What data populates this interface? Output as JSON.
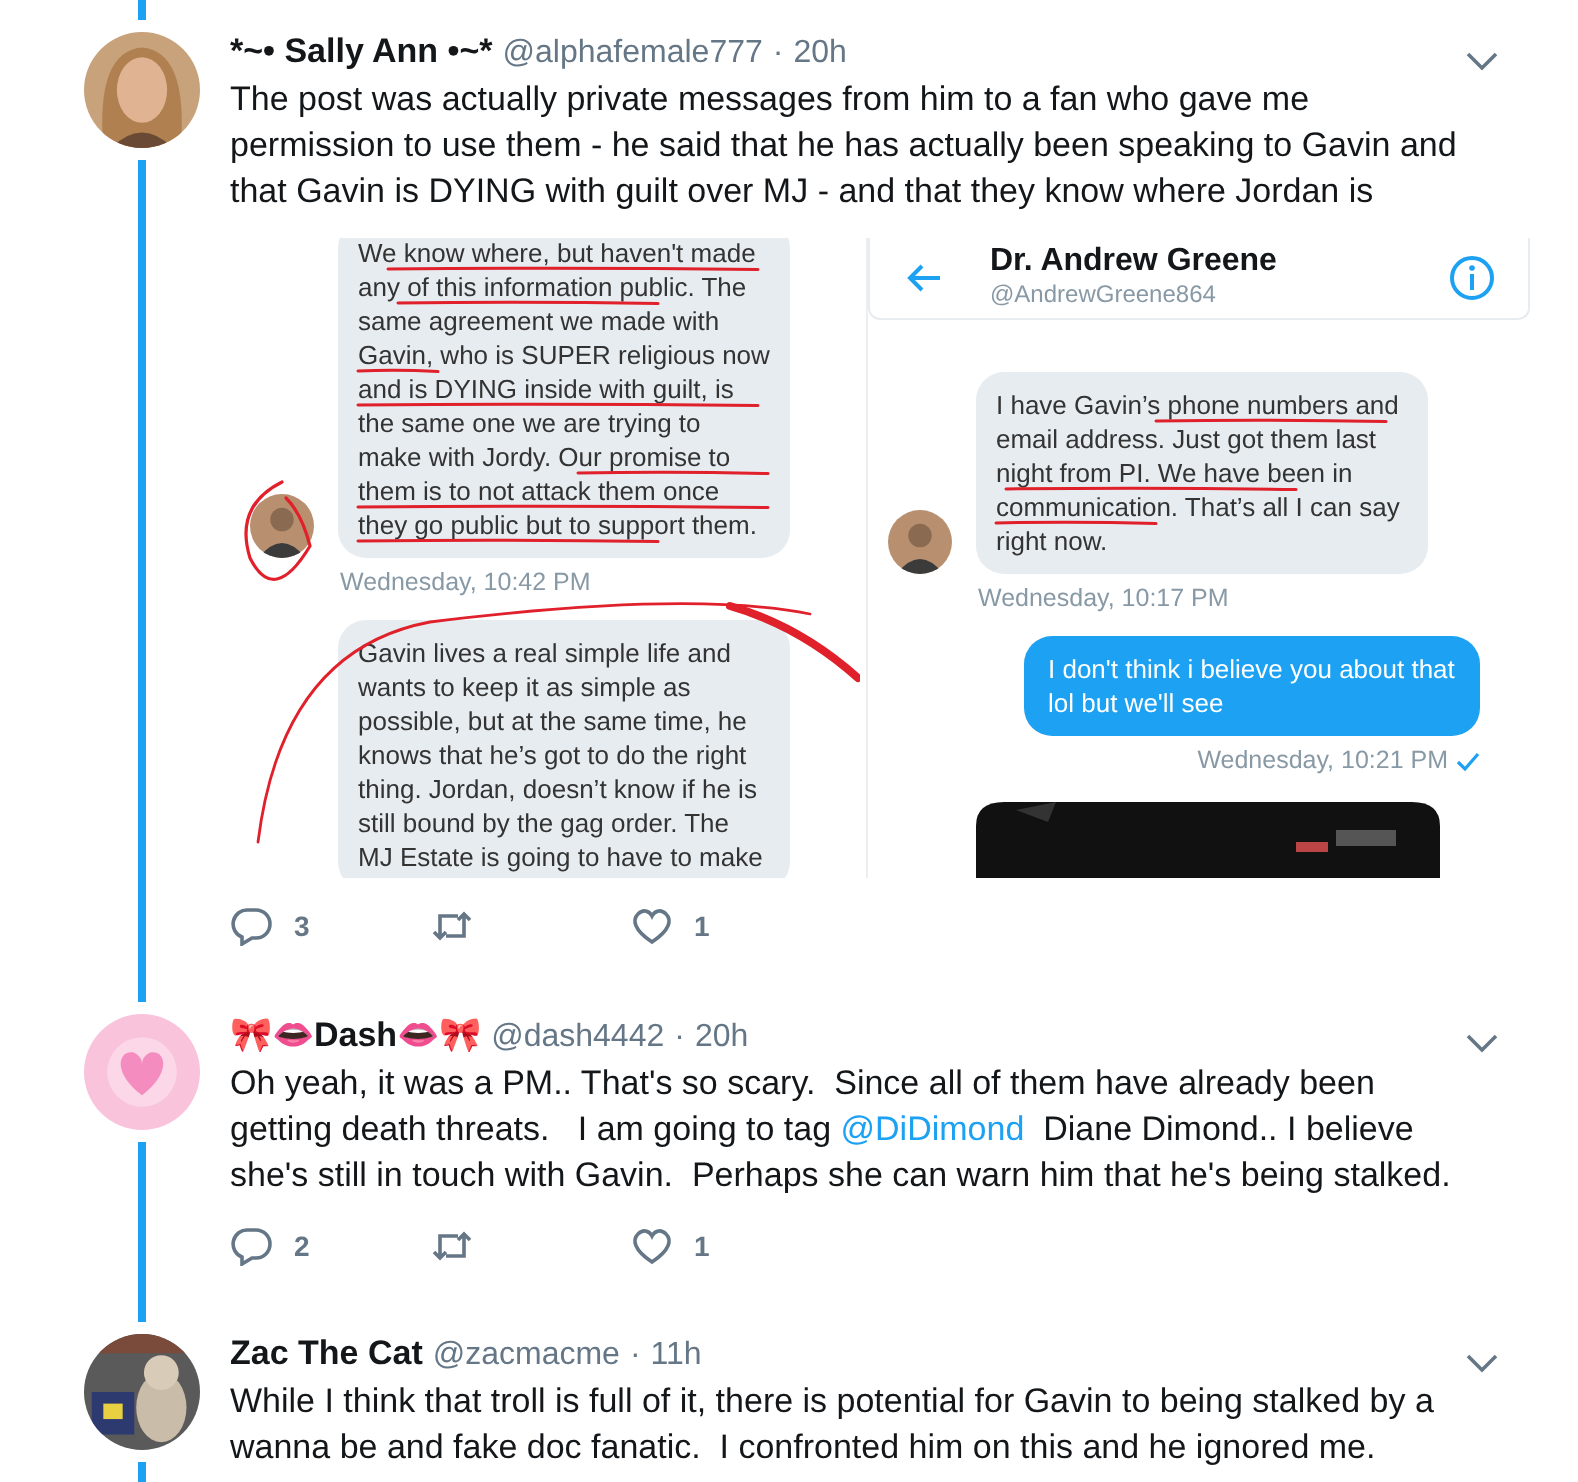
{
  "tweets": [
    {
      "name": "*~• Sally Ann •~*",
      "handle": "@alphafemale777",
      "separator": "·",
      "time": "20h",
      "text": [
        {
          "kind": "text",
          "text": "The post was actually private messages from him to a fan who gave me permission to use them - he said that he has actually been speaking to Gavin and that Gavin is DYING with guilt over MJ - and that they know where Jordan is"
        }
      ],
      "attachment": {
        "left_messages": [
          {
            "kind": "received",
            "avatar": true,
            "text": "We know where, but haven't made any of this information public. The same agreement we made with Gavin, who is SUPER religious now and is DYING inside with guilt, is the same one we are trying to make with Jordy. Our promise to them is to not attack them once they go public but to support them.",
            "timestamp": "Wednesday, 10:42 PM"
          },
          {
            "kind": "received",
            "avatar": false,
            "text": "Gavin lives a real simple life and wants to keep it as simple as possible, but at the same time, he knows that he’s got to do the right thing. Jordan, doesn’t know if he is still bound by the gag order. The MJ Estate is going to have to make"
          }
        ],
        "right_header": {
          "name": "Dr. Andrew Greene",
          "handle": "@AndrewGreene864"
        },
        "right_messages": [
          {
            "kind": "received",
            "avatar": true,
            "text": "I have Gavin’s phone numbers and email address. Just got them last night from PI. We have been in communication. That’s all I can say right now.",
            "timestamp": "Wednesday, 10:17 PM",
            "read": false
          },
          {
            "kind": "sent",
            "text": "I don't think i believe you about that lol but we'll see",
            "timestamp": "Wednesday, 10:21 PM",
            "read": true
          },
          {
            "kind": "picture"
          }
        ]
      },
      "actions": {
        "replies": "3",
        "likes": "1"
      }
    },
    {
      "name": "🎀👄Dash👄🎀",
      "handle": "@dash4442",
      "separator": "·",
      "time": "20h",
      "text": [
        {
          "kind": "text",
          "text": "Oh yeah, it was a PM.. That's so scary.  Since all of them have already been getting death threats.   I am going to tag "
        },
        {
          "kind": "mention",
          "text": "@DiDimond"
        },
        {
          "kind": "text",
          "text": "  Diane Dimond.. I believe she's still in touch with Gavin.  Perhaps she can warn him that he's being stalked."
        }
      ],
      "actions": {
        "replies": "2",
        "likes": "1"
      }
    },
    {
      "name": "Zac The Cat",
      "handle": "@zacmacme",
      "separator": "·",
      "time": "11h",
      "text": [
        {
          "kind": "text",
          "text": "While I think that troll is full of it, there is potential for Gavin to being stalked by a wanna be and fake doc fanatic.  I confronted him on this and he ignored me."
        }
      ]
    }
  ]
}
